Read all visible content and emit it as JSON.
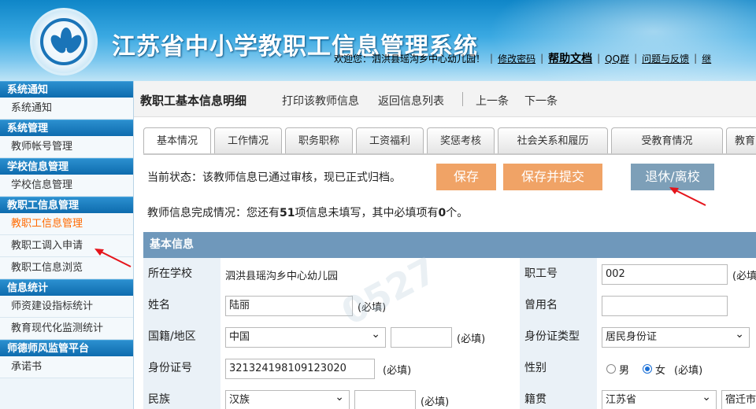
{
  "header": {
    "site_title": "江苏省中小学教职工信息管理系统",
    "welcome": "欢迎您：泗洪县瑶沟乡中心幼儿园！",
    "links": {
      "change_password": "修改密码",
      "help": "帮助文档",
      "qq_group": "QQ群",
      "feedback": "问题与反馈",
      "more": "继"
    }
  },
  "sidebar": {
    "sections": [
      {
        "title": "系统通知",
        "items": [
          "系统通知"
        ]
      },
      {
        "title": "系统管理",
        "items": [
          "教师帐号管理"
        ]
      },
      {
        "title": "学校信息管理",
        "items": [
          "学校信息管理"
        ]
      },
      {
        "title": "教职工信息管理",
        "items": [
          "教职工信息管理",
          "教职工调入申请",
          "教职工信息浏览"
        ]
      },
      {
        "title": "信息统计",
        "items": [
          "师资建设指标统计",
          "教育现代化监测统计"
        ]
      },
      {
        "title": "师德师风监管平台",
        "items": [
          "承诺书"
        ]
      }
    ]
  },
  "toolbar": {
    "page_title": "教职工基本信息明细",
    "print": "打印该教师信息",
    "back": "返回信息列表",
    "prev": "上一条",
    "next": "下一条"
  },
  "tabs": [
    "基本情况",
    "工作情况",
    "职务职称",
    "工资福利",
    "奖惩考核",
    "社会关系和履历",
    "受教育情况",
    "教育"
  ],
  "status": {
    "text": "当前状态：该教师信息已通过审核，现已正式归档。",
    "save": "保存",
    "save_submit": "保存并提交",
    "retire": "退休/离校"
  },
  "completion": {
    "prefix": "教师信息完成情况：您还有",
    "missing": "51",
    "middle": "项信息未填写，其中必填项有",
    "required_missing": "0",
    "suffix": "个。"
  },
  "form": {
    "section_title": "基本信息",
    "required_mark": "(必填)",
    "school_label": "所在学校",
    "school_value": "泗洪县瑶沟乡中心幼儿园",
    "staff_no_label": "职工号",
    "staff_no_value": "002",
    "staff_no_req": "(必填",
    "name_label": "姓名",
    "name_value": "陆丽",
    "former_name_label": "曾用名",
    "former_name_value": "",
    "nationality_label": "国籍/地区",
    "nationality_value": "中国",
    "id_type_label": "身份证类型",
    "id_type_value": "居民身份证",
    "id_no_label": "身份证号",
    "id_no_value": "321324198109123020",
    "gender_label": "性别",
    "gender_male": "男",
    "gender_female": "女",
    "gender_selected": "女",
    "ethnicity_label": "民族",
    "ethnicity_value": "汉族",
    "native_label": "籍贯",
    "native_province": "江苏省",
    "native_city": "宿迁市"
  },
  "colors": {
    "header_blue": "#1a8fd0",
    "sidebar_head": "#1377bb",
    "active_item": "#ff6a00",
    "btn_orange": "#f0a366",
    "btn_blue": "#7d9fb8",
    "section_head": "#6f98bb",
    "arrow_red": "#e5141b"
  }
}
